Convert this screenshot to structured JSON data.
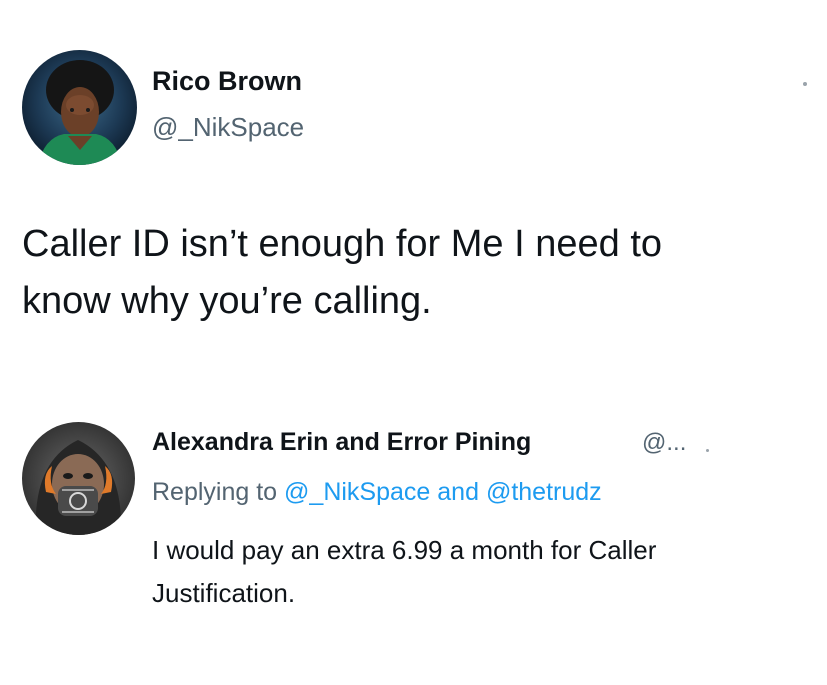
{
  "tweet": {
    "author_name": "Rico Brown",
    "handle": "@_NikSpace",
    "text_lines": [
      "Caller ID isn’t enough for Me I need to",
      "know why you’re calling."
    ],
    "avatar_icon": "profile-photo-icon",
    "more_icon": "more-options-icon"
  },
  "reply": {
    "author_name": "Alexandra Erin and Error Pining",
    "handle_truncated": "@...",
    "replying_label": "Replying to",
    "mention_1": "@_NikSpace",
    "conjunction": "and",
    "mention_2": "@thetrudz",
    "text_lines": [
      "I would pay an extra 6.99 a month for Caller",
      "Justification."
    ],
    "avatar_icon": "profile-photo-icon",
    "more_icon": "more-options-icon"
  },
  "colors": {
    "text": "#0f1419",
    "secondary": "#536471",
    "mention": "#1d9bf0",
    "background": "#ffffff"
  }
}
